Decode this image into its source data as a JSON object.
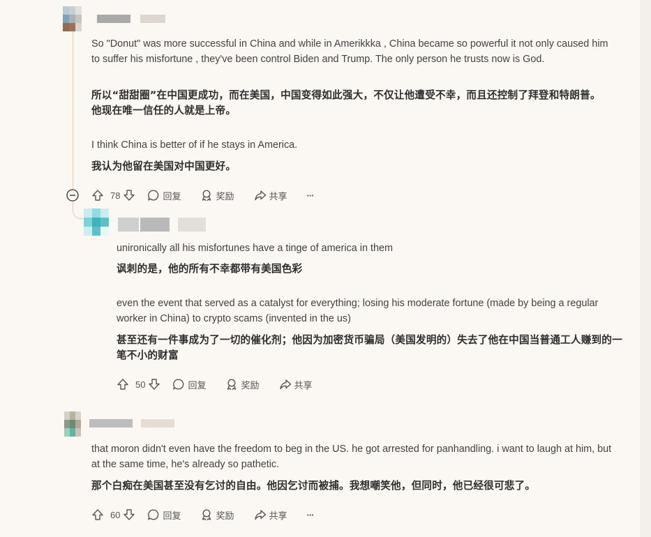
{
  "comments": [
    {
      "en1": "So \"Donut\" was more successful in China and while in Amerikkka , China became so powerful it not only caused him to suffer his misfortune , they've been control Biden and Trump. The only person he trusts now is God.",
      "zh1": "所以“甜甜圈”在中国更成功，而在美国，中国变得如此强大，不仅让他遭受不幸，而且还控制了拜登和特朗普。他现在唯一信任的人就是上帝。",
      "en2": "I think China is better of if he stays in America.",
      "zh2": "我认为他留在美国对中国更好。",
      "votes": "78"
    },
    {
      "en1": "unironically all his misfortunes have a tinge of america in them",
      "zh1": "讽刺的是，他的所有不幸都带有美国色彩",
      "en2": "even the event that served as a catalyst for everything; losing his moderate fortune (made by being a regular worker in China) to crypto scams (invented in the us)",
      "zh2": "甚至还有一件事成为了一切的催化剂；他因为加密货币骗局（美国发明的）失去了他在中国当普通工人赚到的一笔不小的财富",
      "votes": "50"
    },
    {
      "en1": "that moron didn't even have the freedom to beg in the US. he got arrested for panhandling. i want to laugh at him, but at the same time, he's already so pathetic.",
      "zh1": "那个白痴在美国甚至没有乞讨的自由。他因乞讨而被捕。我想嘲笑他，但同时，他已经很可悲了。",
      "votes": "60"
    }
  ],
  "actions": {
    "reply": "回复",
    "award": "奖励",
    "share": "共享",
    "more": "···"
  },
  "icons": [
    "upvote-icon",
    "downvote-icon",
    "reply-icon",
    "award-icon",
    "share-icon",
    "more-icon",
    "collapse-icon"
  ],
  "colors": {
    "background": "#fbf8f3",
    "thread_line": "#e2c9b8"
  }
}
